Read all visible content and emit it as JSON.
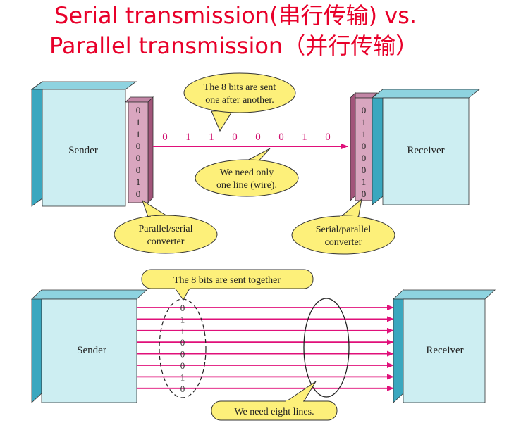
{
  "title": {
    "line1": "Serial transmission(串行传输) vs.",
    "line2": "Parallel transmission（并行传输）"
  },
  "serial": {
    "sender_label": "Sender",
    "receiver_label": "Receiver",
    "sender_bits": [
      "0",
      "1",
      "1",
      "0",
      "0",
      "0",
      "1",
      "0"
    ],
    "receiver_bits": [
      "0",
      "1",
      "1",
      "0",
      "0",
      "0",
      "1",
      "0"
    ],
    "line_bits": [
      "0",
      "1",
      "1",
      "0",
      "0",
      "0",
      "1",
      "0"
    ],
    "callout_sent": [
      "The 8 bits are sent",
      "one after another."
    ],
    "callout_line": [
      "We need only",
      "one line (wire)."
    ],
    "callout_p2s": [
      "Parallel/serial",
      "converter"
    ],
    "callout_s2p": [
      "Serial/parallel",
      "converter"
    ]
  },
  "parallel": {
    "sender_label": "Sender",
    "receiver_label": "Receiver",
    "bits": [
      "0",
      "1",
      "1",
      "0",
      "0",
      "0",
      "1",
      "0"
    ],
    "callout_together": "The 8 bits are sent together",
    "callout_lines": "We need eight lines."
  },
  "colors": {
    "title": "#e8002a",
    "box_face": "#cdeef2",
    "box_side": "#3aa7bf",
    "converter_face": "#d9a6bf",
    "converter_side": "#a2557a",
    "wire": "#e0107a",
    "callout": "#fdf07a"
  }
}
